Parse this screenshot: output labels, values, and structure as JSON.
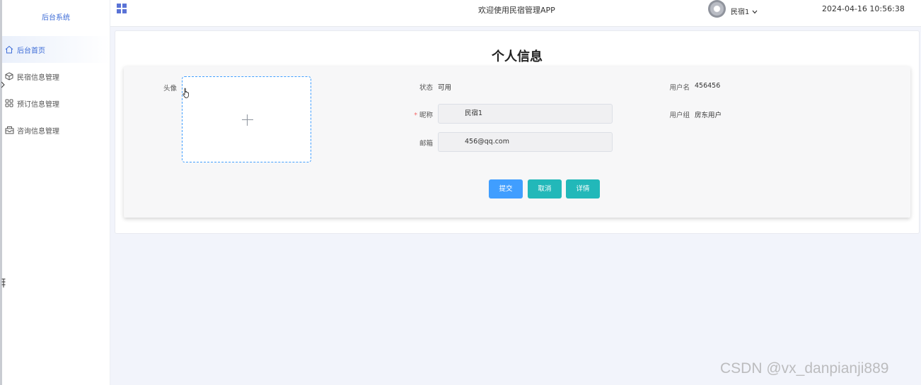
{
  "sidebar": {
    "brand": "后台系统",
    "items": [
      {
        "label": "后台首页",
        "icon": "home-icon"
      },
      {
        "label": "民宿信息管理",
        "icon": "cube-icon"
      },
      {
        "label": "预订信息管理",
        "icon": "apps-grid-icon"
      },
      {
        "label": "咨询信息管理",
        "icon": "inbox-icon"
      }
    ]
  },
  "topbar": {
    "menu_icon": "grid-menu-icon",
    "welcome": "欢迎使用民宿管理APP",
    "user": "民宿1",
    "time": "2024-04-16 10:56:38"
  },
  "page": {
    "title": "个人信息",
    "avatar_label": "头像",
    "status_label": "状态",
    "status_value": "可用",
    "username_label": "用户名",
    "username_value": "456456",
    "nickname_label": "昵称",
    "nickname_value": "民宿1",
    "usergroup_label": "用户组",
    "usergroup_value": "房东用户",
    "email_label": "邮箱",
    "email_value": "456@qq.com"
  },
  "buttons": {
    "submit": "提交",
    "cancel": "取消",
    "detail": "详情"
  },
  "colors": {
    "primary": "#409eff",
    "teal": "#22b8b9",
    "accent": "#3d6cd7",
    "required": "#f56c6c"
  },
  "watermark": "CSDN @vx_danpianji889"
}
